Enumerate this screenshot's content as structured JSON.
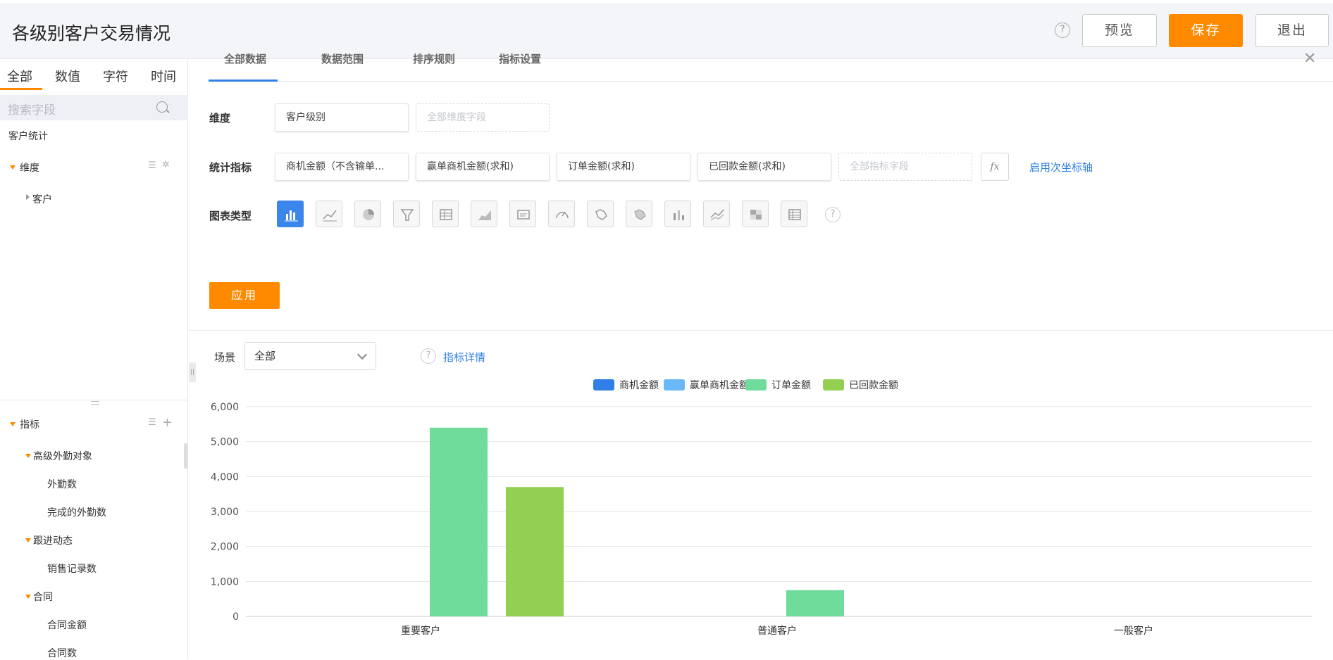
{
  "header": {
    "title": "各级别客户交易情况",
    "help": "?",
    "preview_label": "预览",
    "save_label": "保存",
    "exit_label": "退出"
  },
  "left": {
    "tabs": [
      "全部",
      "数值",
      "字符",
      "时间"
    ],
    "search_placeholder": "搜索字段",
    "group_title": "客户统计",
    "dimension_label": "维度",
    "dimension_items": [
      "客户"
    ],
    "metric_label": "指标",
    "metric_tree": [
      {
        "group": "高级外勤对象",
        "items": [
          "外勤数",
          "完成的外勤数"
        ]
      },
      {
        "group": "跟进动态",
        "items": [
          "销售记录数"
        ]
      },
      {
        "group": "合同",
        "items": [
          "合同金额",
          "合同数"
        ]
      }
    ]
  },
  "config": {
    "tabs_partial": [
      "全部数据",
      "数据范围",
      "排序规则",
      "指标设置"
    ],
    "dimension_row_label": "维度",
    "dimension_fields": [
      "客户级别"
    ],
    "dimension_placeholder": "全部维度字段",
    "metric_row_label": "统计指标",
    "metric_fields": [
      "商机金额（不含输单...",
      "赢单商机金额(求和)",
      "订单金额(求和)",
      "已回款金额(求和)"
    ],
    "metric_placeholder": "全部指标字段",
    "fx_label": "fx",
    "secondary_axis_link": "启用次坐标轴",
    "chart_type_label": "图表类型",
    "chart_types": [
      "bar-chart-icon",
      "line-chart-icon",
      "pie-chart-icon",
      "funnel-chart-icon",
      "table-chart-icon",
      "area-chart-icon",
      "card-chart-icon",
      "gauge-chart-icon",
      "map-chart-icon",
      "map2-chart-icon",
      "stacked-bar-icon",
      "dual-line-icon",
      "heatmap-icon",
      "pivot-table-icon"
    ],
    "apply_label": "应用"
  },
  "scene": {
    "label": "场景",
    "selected": "全部",
    "detail_link": "指标详情"
  },
  "colors": {
    "accent": "#ff8a00",
    "link": "#2f7fe6",
    "series": [
      "#2f7fe6",
      "#6ab8f7",
      "#6fdc9c",
      "#93d052"
    ]
  },
  "chart_data": {
    "type": "bar",
    "categories": [
      "重要客户",
      "普通客户",
      "一般客户"
    ],
    "series": [
      {
        "name": "商机金额",
        "values": [
          0,
          0,
          0
        ]
      },
      {
        "name": "赢单商机金额",
        "values": [
          0,
          0,
          0
        ]
      },
      {
        "name": "订单金额",
        "values": [
          5400,
          750,
          0
        ]
      },
      {
        "name": "已回款金额",
        "values": [
          3700,
          0,
          0
        ]
      }
    ],
    "yticks": [
      "0",
      "1,000",
      "2,000",
      "3,000",
      "4,000",
      "5,000",
      "6,000"
    ],
    "ylim": [
      0,
      6000
    ],
    "grid": true,
    "legend_position": "top-center"
  }
}
